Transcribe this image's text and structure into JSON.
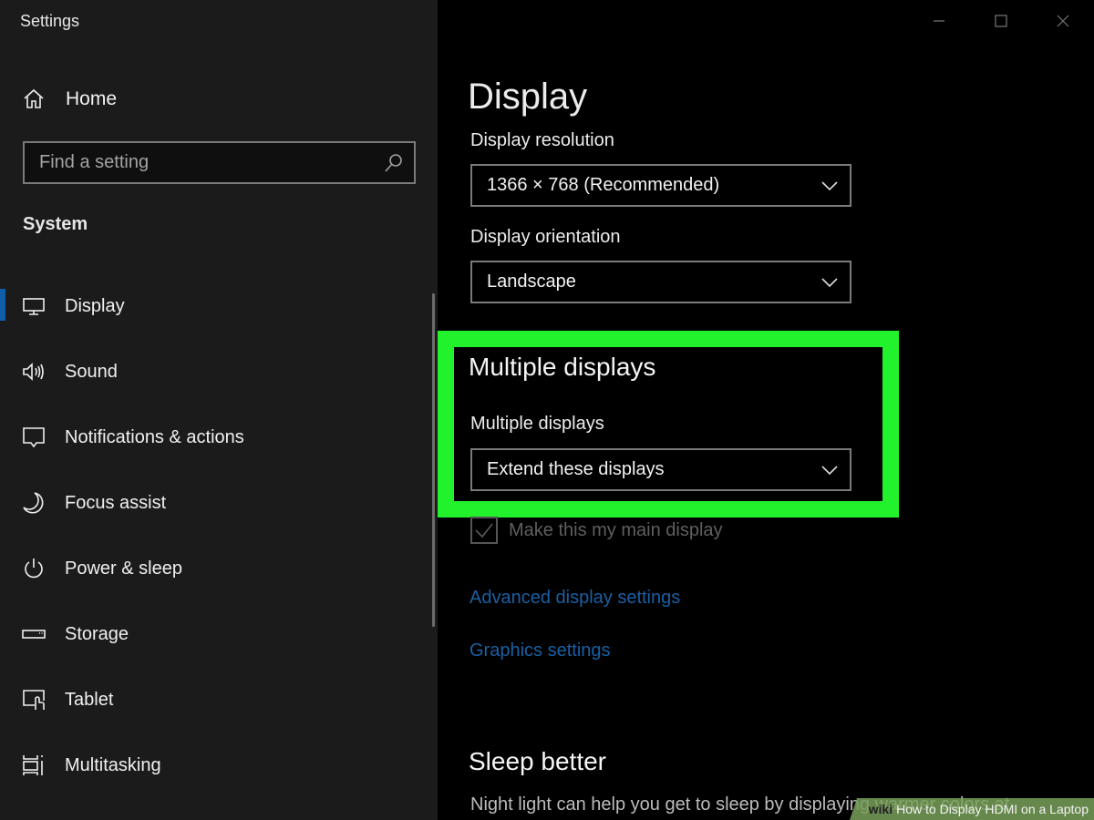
{
  "window": {
    "title": "Settings",
    "controls": [
      "minimize-icon",
      "maximize-icon",
      "close-icon"
    ]
  },
  "sidebar": {
    "home": {
      "icon": "home-icon",
      "label": "Home"
    },
    "search": {
      "placeholder": "Find a setting",
      "value": "",
      "icon": "search-icon"
    },
    "section_label": "System",
    "items": [
      {
        "icon": "monitor-icon",
        "label": "Display",
        "selected": true
      },
      {
        "icon": "speaker-icon",
        "label": "Sound",
        "selected": false
      },
      {
        "icon": "notification-icon",
        "label": "Notifications & actions",
        "selected": false
      },
      {
        "icon": "moon-icon",
        "label": "Focus assist",
        "selected": false
      },
      {
        "icon": "power-icon",
        "label": "Power & sleep",
        "selected": false
      },
      {
        "icon": "storage-icon",
        "label": "Storage",
        "selected": false
      },
      {
        "icon": "tablet-icon",
        "label": "Tablet",
        "selected": false
      },
      {
        "icon": "multitasking-icon",
        "label": "Multitasking",
        "selected": false
      }
    ],
    "accent_color": "#0f5ea8"
  },
  "main": {
    "title": "Display",
    "resolution": {
      "label": "Display resolution",
      "value": "1366 × 768 (Recommended)"
    },
    "orientation": {
      "label": "Display orientation",
      "value": "Landscape"
    },
    "multiple_displays": {
      "heading": "Multiple displays",
      "label": "Multiple displays",
      "value": "Extend these displays",
      "highlight_color": "#22f22b"
    },
    "main_display_checkbox": {
      "label": "Make this my main display",
      "checked": true,
      "disabled": true
    },
    "links": [
      "Advanced display settings",
      "Graphics settings"
    ],
    "link_color": "#1a5fa3",
    "sleep": {
      "heading": "Sleep better",
      "text": "Night light can help you get to sleep by displaying warmer colors at"
    }
  },
  "watermark": {
    "brand": "wiki",
    "text": "How to Display HDMI on a Laptop"
  }
}
